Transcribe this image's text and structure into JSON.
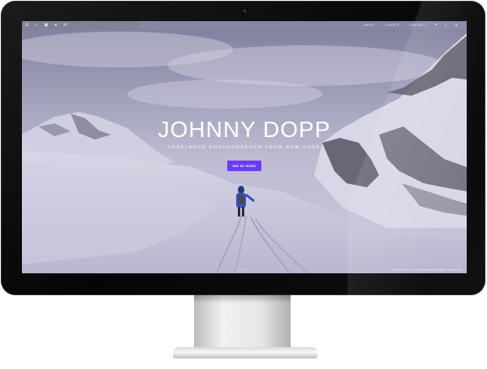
{
  "navbar": {
    "left_icons": [
      "menu-icon",
      "home-icon",
      "briefcase-icon",
      "user-icon",
      "mail-icon"
    ],
    "links": [
      "ABOUT",
      "CLIENTS",
      "CONTACT"
    ],
    "social_icons": [
      "twitter-icon",
      "facebook-icon",
      "instagram-icon"
    ]
  },
  "hero": {
    "title": "JOHNNY DOPP",
    "subtitle": "FREELANCE PHOTOGRAPHER FROM NEW YORK",
    "button_label": "SEE MY WORK"
  },
  "footer": {
    "copyright": "Copyright © 2017-2018 PhiloDeMesa Template. Made for you.",
    "center_label": "SCROLL"
  },
  "colors": {
    "accent_button": "#6a3df5",
    "bezel": "#0b0b0b",
    "title_text": "#ffffff"
  }
}
